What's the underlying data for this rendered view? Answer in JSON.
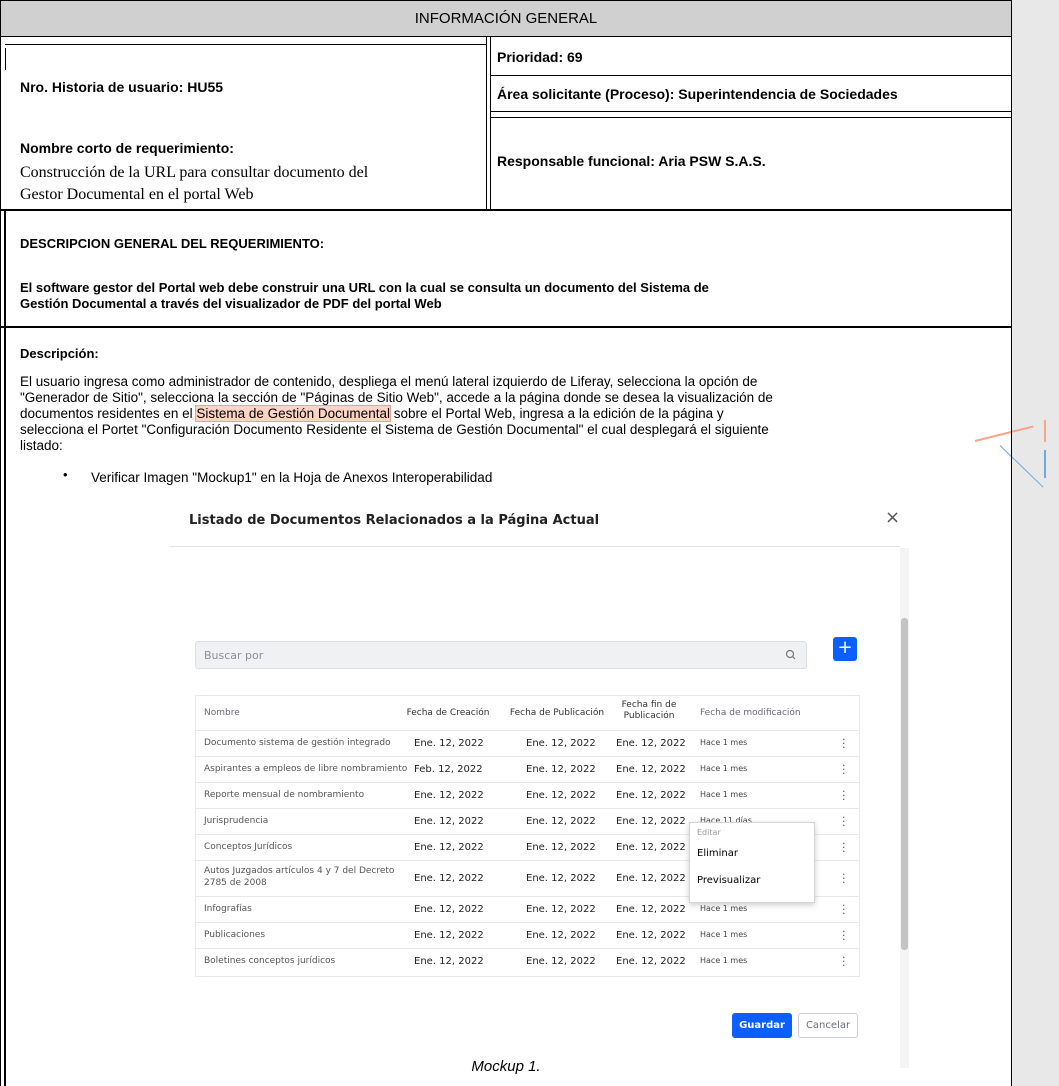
{
  "header": {
    "title": "INFORMACIÓN GENERAL"
  },
  "info": {
    "story_label": "Nro. Historia de usuario:  HU55",
    "priority_label": "Prioridad:  69",
    "area_label": "Área solicitante (Proceso): Superintendencia de Sociedades",
    "short_name_label": "Nombre corto de requerimiento:",
    "short_name_line1": "Construcción de la URL para consultar documento del",
    "short_name_line2": "Gestor Documental en el portal Web",
    "responsible_label": "Responsable funcional: Aria PSW S.A.S."
  },
  "general": {
    "heading": "DESCRIPCION GENERAL DEL REQUERIMIENTO:",
    "text_line1": "El software gestor del Portal web debe construir una URL con la cual se consulta un documento del Sistema de",
    "text_line2": "Gestión Documental a través del visualizador de PDF del portal Web"
  },
  "description": {
    "heading": "Descripción:",
    "line1": "El usuario ingresa como administrador de contenido, despliega el menú lateral izquierdo de Liferay, selecciona la opción de",
    "line2": "\"Generador de Sitio\", selecciona la sección de \"Páginas de Sitio Web\", accede a la página donde se desea la visualización de",
    "line3_pre": "documentos residentes en el ",
    "line3_highlight": "Sistema de Gestión Documental",
    "line3_post": " sobre el Portal Web, ingresa a la edición de la página y",
    "line4": "selecciona el Portet \"Configuración Documento Residente el Sistema de Gestión Documental\" el cual desplegará el siguiente",
    "line5": "listado:",
    "bullet": "Verificar Imagen \"Mockup1\" en la Hoja de Anexos Interoperabilidad"
  },
  "mockup": {
    "title": "Listado de Documentos Relacionados a la Página Actual",
    "close": "×",
    "search_placeholder": "Buscar por",
    "add": "+",
    "columns": {
      "name": "Nombre",
      "created": "Fecha de Creación",
      "published": "Fecha de Publicación",
      "end_pub_1": "Fecha fin de",
      "end_pub_2": "Publicación",
      "modified": "Fecha de modificación"
    },
    "rows": [
      {
        "name": "Documento sistema de gestión integrado",
        "created": "Ene. 12, 2022",
        "published": "Ene. 12, 2022",
        "end": "Ene. 12, 2022",
        "modified": "Hace 1 mes"
      },
      {
        "name": "Aspirantes a empleos de libre nombramiento",
        "created": "Feb. 12, 2022",
        "published": "Ene. 12, 2022",
        "end": "Ene. 12, 2022",
        "modified": "Hace 1 mes"
      },
      {
        "name": "Reporte mensual de nombramiento",
        "created": "Ene. 12, 2022",
        "published": "Ene. 12, 2022",
        "end": "Ene. 12, 2022",
        "modified": "Hace 1 mes"
      },
      {
        "name": "Jurisprudencia",
        "created": "Ene. 12, 2022",
        "published": "Ene. 12, 2022",
        "end": "Ene. 12, 2022",
        "modified": "Hace 11 días"
      },
      {
        "name": "Conceptos Jurídicos",
        "created": "Ene. 12, 2022",
        "published": "Ene. 12, 2022",
        "end": "Ene. 12, 2022",
        "modified": ""
      },
      {
        "name": "Autos Juzgados artículos 4 y 7 del Decreto",
        "name2": "2785 de 2008",
        "created": "Ene. 12, 2022",
        "published": "Ene. 12, 2022",
        "end": "Ene. 12, 2022",
        "modified": ""
      },
      {
        "name": "Infografías",
        "created": "Ene. 12, 2022",
        "published": "Ene. 12, 2022",
        "end": "Ene. 12, 2022",
        "modified": "Hace 1 mes"
      },
      {
        "name": "Publicaciones",
        "created": "Ene. 12, 2022",
        "published": "Ene. 12, 2022",
        "end": "Ene. 12, 2022",
        "modified": "Hace 1 mes"
      },
      {
        "name": "Boletines conceptos jurídicos",
        "created": "Ene. 12, 2022",
        "published": "Ene. 12, 2022",
        "end": "Ene. 12, 2022",
        "modified": "Hace 1 mes"
      }
    ],
    "menu": {
      "edit": "Editar",
      "delete": "Eliminar",
      "preview": "Previsualizar"
    },
    "save": "Guardar",
    "cancel": "Cancelar",
    "caption": "Mockup 1."
  }
}
